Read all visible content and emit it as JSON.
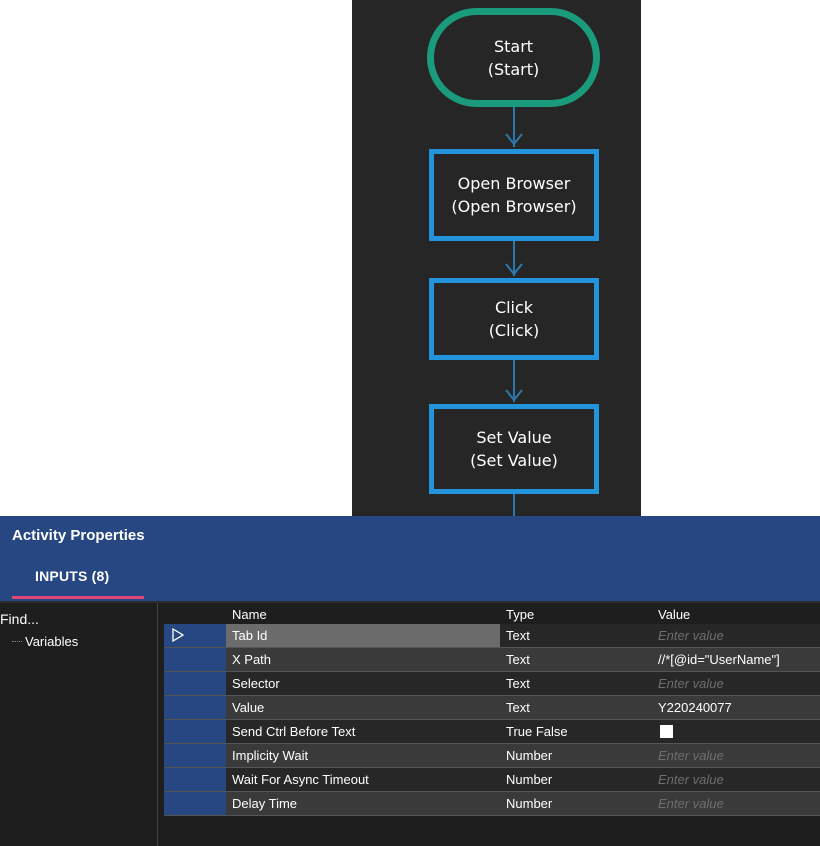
{
  "flowchart": {
    "nodes": [
      {
        "title": "Start",
        "subtitle": "(Start)"
      },
      {
        "title": "Open Browser",
        "subtitle": "(Open Browser)"
      },
      {
        "title": "Click",
        "subtitle": "(Click)"
      },
      {
        "title": "Set Value",
        "subtitle": "(Set Value)"
      }
    ],
    "colors": {
      "start_border": "#1a9b7b",
      "activity_border": "#2393dc",
      "connector": "#2a79ad",
      "canvas": "#262626"
    }
  },
  "properties": {
    "title": "Activity Properties",
    "tab": "INPUTS (8)",
    "find_label": "Find...",
    "tree_item": "Variables",
    "columns": {
      "name": "Name",
      "type": "Type",
      "value": "Value"
    },
    "rows": [
      {
        "name": "Tab Id",
        "type": "Text",
        "value": "",
        "placeholder": "Enter value"
      },
      {
        "name": "X Path",
        "type": "Text",
        "value": "//*[@id=\"UserName\"]",
        "placeholder": ""
      },
      {
        "name": "Selector",
        "type": "Text",
        "value": "",
        "placeholder": "Enter value"
      },
      {
        "name": "Value",
        "type": "Text",
        "value": "Y220240077",
        "placeholder": ""
      },
      {
        "name": "Send Ctrl Before Text",
        "type": "True False",
        "value": "",
        "placeholder": "",
        "checkbox": true
      },
      {
        "name": "Implicity Wait",
        "type": "Number",
        "value": "",
        "placeholder": "Enter value"
      },
      {
        "name": "Wait For Async Timeout",
        "type": "Number",
        "value": "",
        "placeholder": "Enter value"
      },
      {
        "name": "Delay Time",
        "type": "Number",
        "value": "",
        "placeholder": "Enter value"
      }
    ],
    "colors": {
      "header": "#274783",
      "tab_underline": "#e0467a",
      "selected_cell": "#6c6c6c"
    }
  }
}
